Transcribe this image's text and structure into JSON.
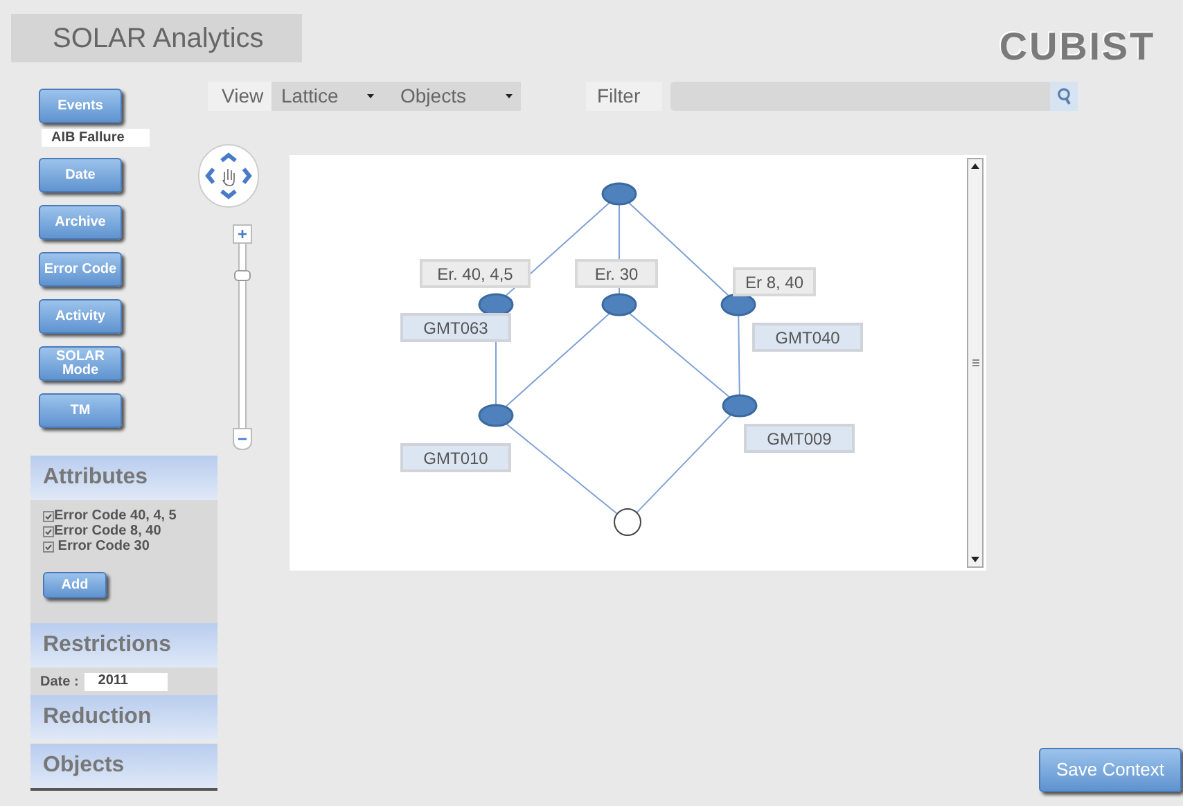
{
  "title": "SOLAR Analytics",
  "logo": "CUBIST",
  "toolbar": {
    "view_label": "View",
    "dropdowns": [
      {
        "label": "Lattice"
      },
      {
        "label": "Objects"
      }
    ],
    "filter_label": "Filter"
  },
  "sidebar": {
    "buttons": [
      {
        "label": "Events"
      },
      {
        "label": "Date"
      },
      {
        "label": "Archive"
      },
      {
        "label": "Error Code"
      },
      {
        "label": "Activity"
      },
      {
        "label": "SOLAR Mode"
      },
      {
        "label": "TM"
      }
    ],
    "event_value": "AIB Fallure"
  },
  "zoom": {
    "level": 0.83,
    "plus": "+",
    "minus": "−"
  },
  "attributes": {
    "title": "Attributes",
    "items": [
      {
        "label": "Error Code 40, 4, 5",
        "checked": true
      },
      {
        "label": "Error Code 8, 40",
        "checked": true
      },
      {
        "label": " Error Code 30",
        "checked": true
      }
    ],
    "add_button": "Add"
  },
  "restrictions": {
    "title": "Restrictions",
    "date_label": "Date :",
    "date_value": "2011"
  },
  "reduction": {
    "title": "Reduction"
  },
  "objects": {
    "title": "Objects"
  },
  "lattice": {
    "nodes": [
      {
        "filled": true
      },
      {
        "filled": true
      },
      {
        "filled": true
      },
      {
        "filled": true
      },
      {
        "filled": true
      },
      {
        "filled": true
      },
      {
        "filled": false
      }
    ],
    "attribute_labels": [
      "Er. 40, 4,5",
      "Er. 30",
      "Er 8, 40"
    ],
    "object_labels": [
      "GMT063",
      "GMT040",
      "GMT009",
      "GMT010"
    ]
  },
  "save_button": "Save Context"
}
